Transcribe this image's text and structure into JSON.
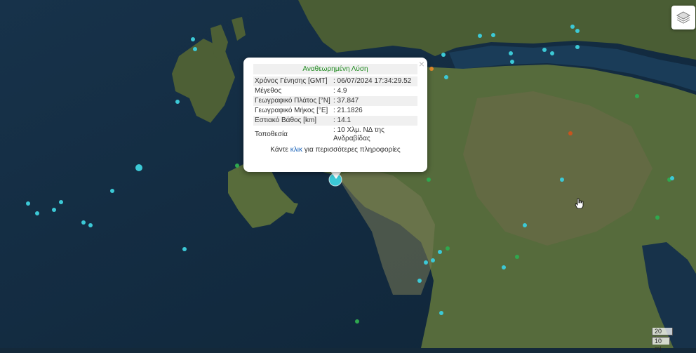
{
  "popup": {
    "title": "Αναθεωρημένη Λύση",
    "close": "×",
    "rows": [
      {
        "label": "Χρόνος Γένησης [GMT]",
        "value": ": 06/07/2024 17:34:29.52"
      },
      {
        "label": "Μέγεθος",
        "value": ": 4.9"
      },
      {
        "label": "Γεωγραφικό Πλάτος [°N]",
        "value": ": 37.847"
      },
      {
        "label": "Γεωγραφικό Μήκος [°E]",
        "value": ": 21.1826"
      },
      {
        "label": "Εστιακό Βάθος [km]",
        "value": ": 14.1"
      },
      {
        "label": "Τοποθεσία",
        "value": ": 10 Χλμ. ΝΔ της Ανδραβίδας"
      }
    ],
    "footer_before": "Κάντε ",
    "footer_link": "κλικ",
    "footer_after": " για περισσότερες πληροφορίες"
  },
  "scale": {
    "km": "20 km",
    "mi": "10 mi"
  },
  "icons": {
    "layers": "layers-icon",
    "cursor": "hand-cursor-icon"
  },
  "colors": {
    "marker_cyan": "#3cc9d6",
    "marker_green": "#2fa84f",
    "marker_orange": "#e0892a",
    "marker_red": "#c8541e",
    "title_green": "#1f8a1f",
    "link_blue": "#1a63b8"
  }
}
